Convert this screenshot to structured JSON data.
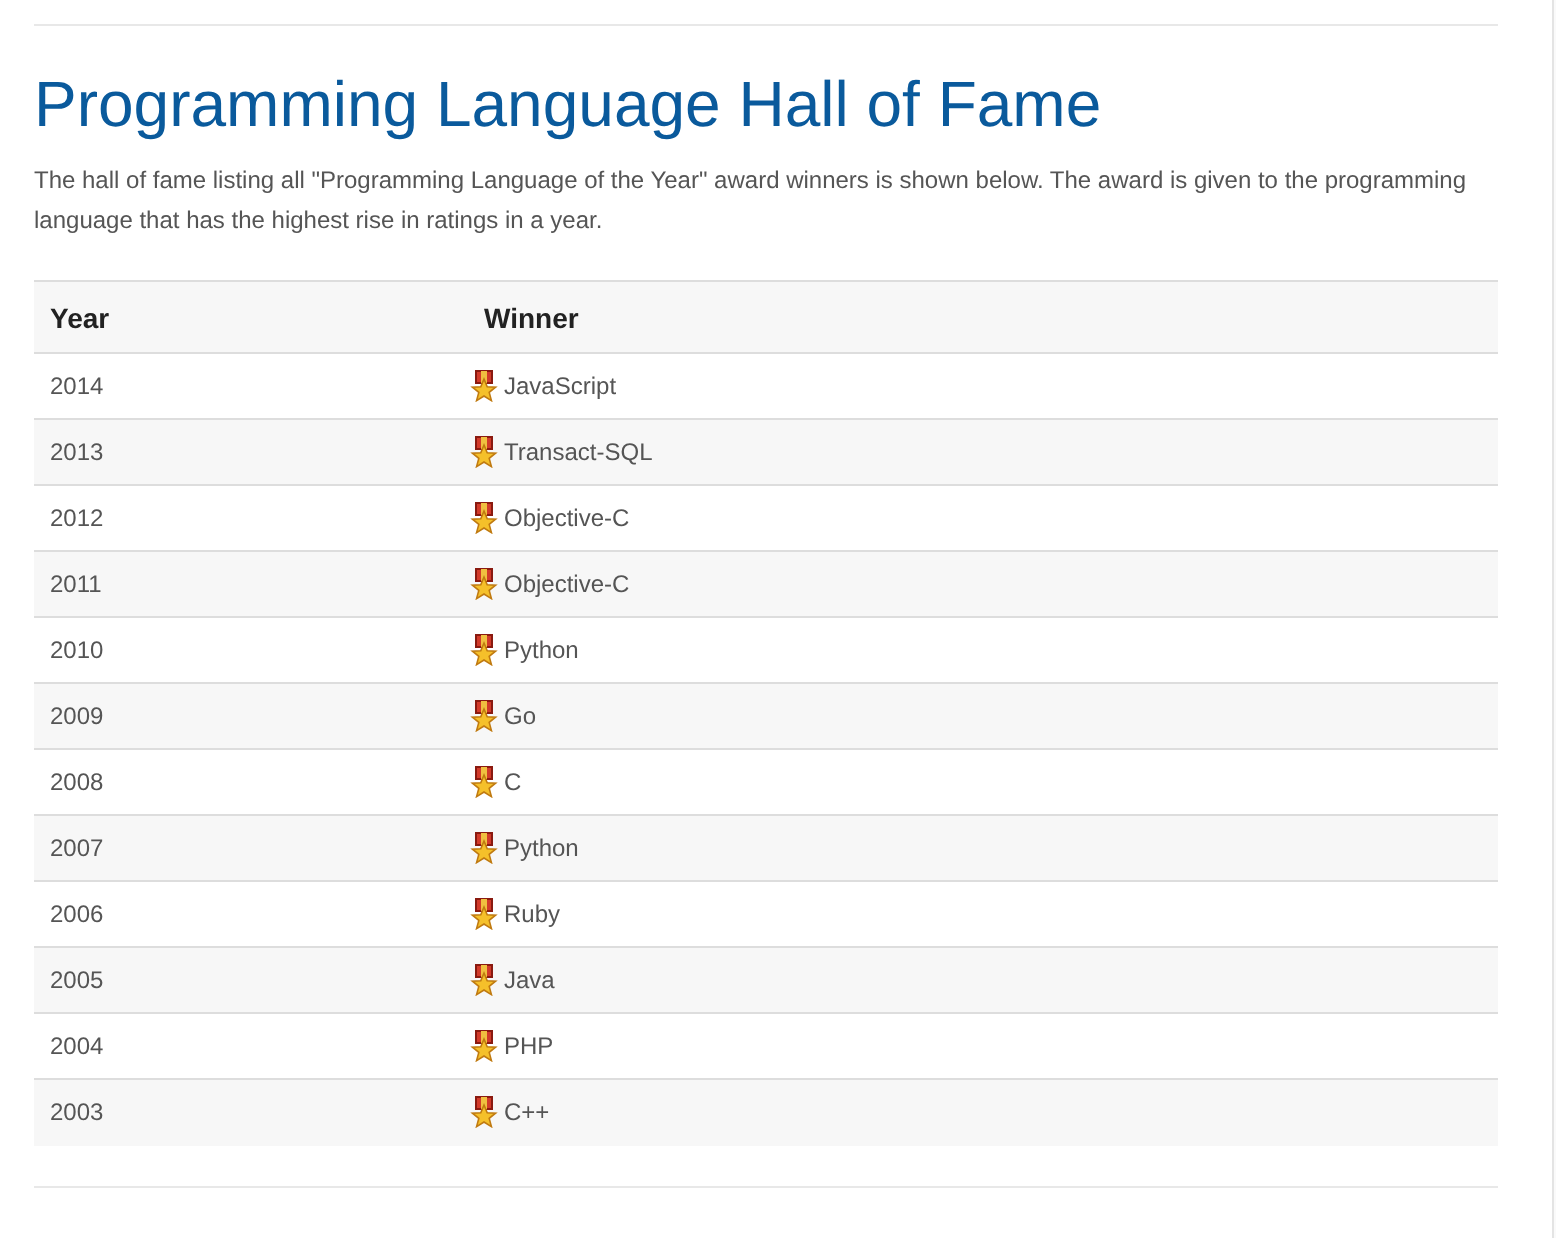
{
  "title": "Programming Language Hall of Fame",
  "intro": "The hall of fame listing all \"Programming Language of the Year\" award winners is shown below. The award is given to the programming language that has the highest rise in ratings in a year.",
  "table": {
    "columns": [
      "Year",
      "Winner"
    ],
    "rows": [
      {
        "year": "2014",
        "winner": "JavaScript"
      },
      {
        "year": "2013",
        "winner": "Transact-SQL"
      },
      {
        "year": "2012",
        "winner": "Objective-C"
      },
      {
        "year": "2011",
        "winner": "Objective-C"
      },
      {
        "year": "2010",
        "winner": "Python"
      },
      {
        "year": "2009",
        "winner": "Go"
      },
      {
        "year": "2008",
        "winner": "C"
      },
      {
        "year": "2007",
        "winner": "Python"
      },
      {
        "year": "2006",
        "winner": "Ruby"
      },
      {
        "year": "2005",
        "winner": "Java"
      },
      {
        "year": "2004",
        "winner": "PHP"
      },
      {
        "year": "2003",
        "winner": "C++"
      }
    ]
  }
}
